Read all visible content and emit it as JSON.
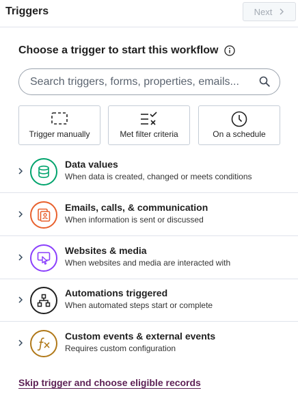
{
  "header": {
    "title": "Triggers",
    "next_label": "Next"
  },
  "main": {
    "heading": "Choose a trigger to start this workflow",
    "search": {
      "placeholder": "Search triggers, forms, properties, emails..."
    },
    "trigger_types": [
      {
        "label": "Trigger manually",
        "icon": "dashed-square-icon"
      },
      {
        "label": "Met filter criteria",
        "icon": "filter-check-icon"
      },
      {
        "label": "On a schedule",
        "icon": "clock-icon"
      }
    ],
    "categories": [
      {
        "title": "Data values",
        "description": "When data is created, changed or meets conditions",
        "icon": "database-icon",
        "color": "#00a36c"
      },
      {
        "title": "Emails, calls, & communication",
        "description": "When information is sent or discussed",
        "icon": "contact-card-icon",
        "color": "#e8602c"
      },
      {
        "title": "Websites & media",
        "description": "When websites and media are interacted with",
        "icon": "pointer-click-icon",
        "color": "#8a3ffc"
      },
      {
        "title": "Automations triggered",
        "description": "When automated steps start or complete",
        "icon": "workflow-tree-icon",
        "color": "#1f1f1f"
      },
      {
        "title": "Custom events & external events",
        "description": "Requires custom configuration",
        "icon": "function-icon",
        "color": "#b07818"
      }
    ],
    "skip_link": "Skip trigger and choose eligible records"
  }
}
